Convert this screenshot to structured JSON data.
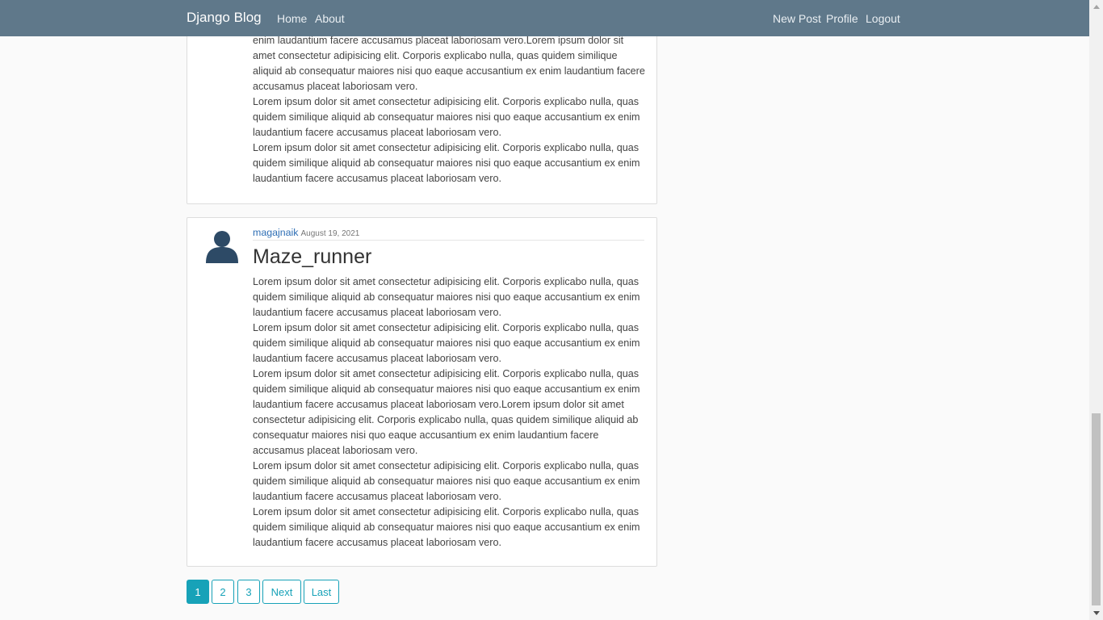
{
  "nav": {
    "brand": "Django Blog",
    "home": "Home",
    "about": "About",
    "new_post": "New Post",
    "profile": "Profile",
    "logout": "Logout"
  },
  "post1": {
    "p1": "enim laudantium facere accusamus placeat laboriosam vero.Lorem ipsum dolor sit amet consectetur adipisicing elit. Corporis explicabo nulla, quas quidem similique aliquid ab consequatur maiores nisi quo eaque accusantium ex enim laudantium facere accusamus placeat laboriosam vero.",
    "p2": "Lorem ipsum dolor sit amet consectetur adipisicing elit. Corporis explicabo nulla, quas quidem similique aliquid ab consequatur maiores nisi quo eaque accusantium ex enim laudantium facere accusamus placeat laboriosam vero.",
    "p3": "Lorem ipsum dolor sit amet consectetur adipisicing elit. Corporis explicabo nulla, quas quidem similique aliquid ab consequatur maiores nisi quo eaque accusantium ex enim laudantium facere accusamus placeat laboriosam vero."
  },
  "post2": {
    "author": "magajnaik",
    "date": "August 19, 2021",
    "title": "Maze_runner",
    "p1": "Lorem ipsum dolor sit amet consectetur adipisicing elit. Corporis explicabo nulla, quas quidem similique aliquid ab consequatur maiores nisi quo eaque accusantium ex enim laudantium facere accusamus placeat laboriosam vero.",
    "p2": "Lorem ipsum dolor sit amet consectetur adipisicing elit. Corporis explicabo nulla, quas quidem similique aliquid ab consequatur maiores nisi quo eaque accusantium ex enim laudantium facere accusamus placeat laboriosam vero.",
    "p3": "Lorem ipsum dolor sit amet consectetur adipisicing elit. Corporis explicabo nulla, quas quidem similique aliquid ab consequatur maiores nisi quo eaque accusantium ex enim laudantium facere accusamus placeat laboriosam vero.Lorem ipsum dolor sit amet consectetur adipisicing elit. Corporis explicabo nulla, quas quidem similique aliquid ab consequatur maiores nisi quo eaque accusantium ex enim laudantium facere accusamus placeat laboriosam vero.",
    "p4": "Lorem ipsum dolor sit amet consectetur adipisicing elit. Corporis explicabo nulla, quas quidem similique aliquid ab consequatur maiores nisi quo eaque accusantium ex enim laudantium facere accusamus placeat laboriosam vero.",
    "p5": "Lorem ipsum dolor sit amet consectetur adipisicing elit. Corporis explicabo nulla, quas quidem similique aliquid ab consequatur maiores nisi quo eaque accusantium ex enim laudantium facere accusamus placeat laboriosam vero."
  },
  "pagination": {
    "p1": "1",
    "p2": "2",
    "p3": "3",
    "next": "Next",
    "last": "Last"
  },
  "colors": {
    "navbar": "#5f788a",
    "accent": "#17a2b8",
    "link": "#2f6fb5"
  }
}
